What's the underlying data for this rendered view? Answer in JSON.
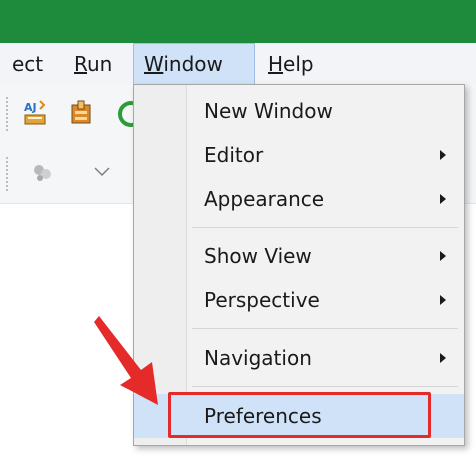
{
  "menubar": {
    "items": [
      {
        "prefix": "ect",
        "underline": "",
        "rest": ""
      },
      {
        "prefix": "",
        "underline": "R",
        "rest": "un"
      },
      {
        "prefix": "",
        "underline": "W",
        "rest": "indow"
      },
      {
        "prefix": "",
        "underline": "H",
        "rest": "elp"
      }
    ]
  },
  "toolbar": {
    "icons": [
      "ajax-wizard-icon",
      "package-icon",
      "run-icon",
      "element-icon",
      "dropdown-arrow-icon"
    ]
  },
  "window_menu": {
    "items": [
      {
        "label": "New Window",
        "submenu": false
      },
      {
        "label": "Editor",
        "submenu": true
      },
      {
        "label": "Appearance",
        "submenu": true
      },
      {
        "label": "Show View",
        "submenu": true
      },
      {
        "label": "Perspective",
        "submenu": true
      },
      {
        "label": "Navigation",
        "submenu": true
      },
      {
        "label": "Preferences",
        "submenu": false
      }
    ],
    "highlighted": "Preferences"
  },
  "colors": {
    "titlebar": "#1d8a3c",
    "menu_active": "#cfe2f8",
    "annotation_red": "#e52a2a"
  }
}
